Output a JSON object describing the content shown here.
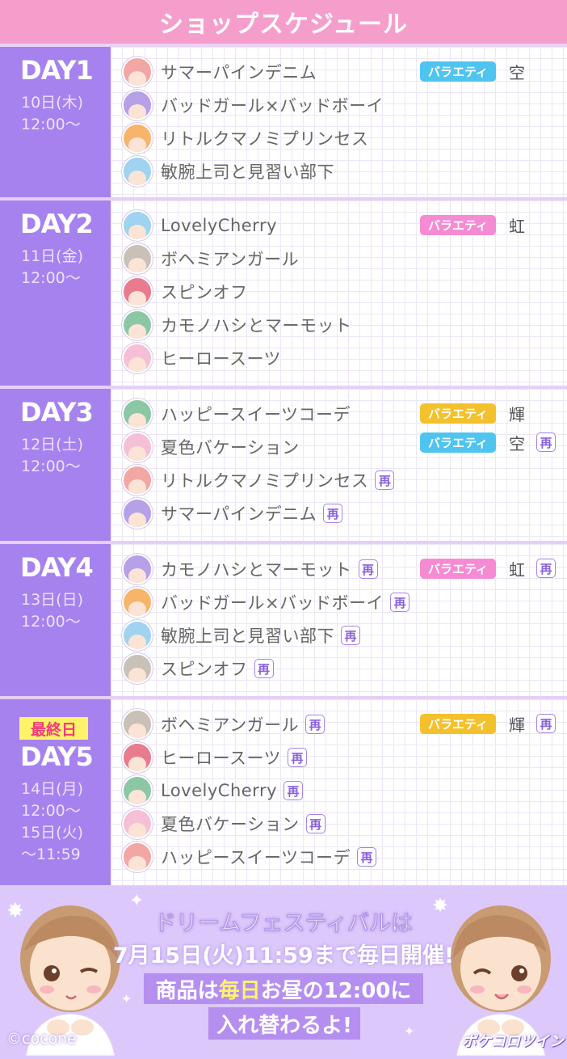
{
  "header": {
    "title": "ショップスケジュール"
  },
  "colors": {
    "header": "#f59ecb",
    "day_panel": "#a682ef",
    "variety_sky": "#4fc4ef",
    "variety_pink": "#f58bd3",
    "variety_gold": "#f3c12b",
    "final_badge": "#fff36a"
  },
  "re_label": "再",
  "days": [
    {
      "label": "DAY1",
      "info": "10日(木)\n12:00〜",
      "final_badge": "",
      "items": [
        {
          "name": "サマーパインデニム",
          "re": false,
          "icon": "avatar-icon"
        },
        {
          "name": "バッドガール×バッドボーイ",
          "re": false,
          "icon": "avatar-icon"
        },
        {
          "name": "リトルクマノミプリンセス",
          "re": false,
          "icon": "avatar-icon"
        },
        {
          "name": "敏腕上司と見習い部下",
          "re": false,
          "icon": "avatar-icon"
        }
      ],
      "variety": [
        {
          "badge": "バラエティ",
          "kind": "空",
          "color": "sky",
          "re": false
        }
      ]
    },
    {
      "label": "DAY2",
      "info": "11日(金)\n12:00〜",
      "final_badge": "",
      "items": [
        {
          "name": "LovelyCherry",
          "re": false,
          "icon": "avatar-icon"
        },
        {
          "name": "ボヘミアンガール",
          "re": false,
          "icon": "avatar-icon"
        },
        {
          "name": "スピンオフ",
          "re": false,
          "icon": "avatar-icon"
        },
        {
          "name": "カモノハシとマーモット",
          "re": false,
          "icon": "avatar-icon"
        },
        {
          "name": "ヒーロースーツ",
          "re": false,
          "icon": "avatar-icon"
        }
      ],
      "variety": [
        {
          "badge": "バラエティ",
          "kind": "虹",
          "color": "pink",
          "re": false
        }
      ]
    },
    {
      "label": "DAY3",
      "info": "12日(土)\n12:00〜",
      "final_badge": "",
      "items": [
        {
          "name": "ハッピースイーツコーデ",
          "re": false,
          "icon": "avatar-icon"
        },
        {
          "name": "夏色バケーション",
          "re": false,
          "icon": "avatar-icon"
        },
        {
          "name": "リトルクマノミプリンセス",
          "re": true,
          "icon": "avatar-icon"
        },
        {
          "name": "サマーパインデニム",
          "re": true,
          "icon": "avatar-icon"
        }
      ],
      "variety": [
        {
          "badge": "バラエティ",
          "kind": "輝",
          "color": "gold",
          "re": false
        },
        {
          "badge": "バラエティ",
          "kind": "空",
          "color": "sky",
          "re": true
        }
      ]
    },
    {
      "label": "DAY4",
      "info": "13日(日)\n12:00〜",
      "final_badge": "",
      "items": [
        {
          "name": "カモノハシとマーモット",
          "re": true,
          "icon": "avatar-icon"
        },
        {
          "name": "バッドガール×バッドボーイ",
          "re": true,
          "icon": "avatar-icon"
        },
        {
          "name": "敏腕上司と見習い部下",
          "re": true,
          "icon": "avatar-icon"
        },
        {
          "name": "スピンオフ",
          "re": true,
          "icon": "avatar-icon"
        }
      ],
      "variety": [
        {
          "badge": "バラエティ",
          "kind": "虹",
          "color": "pink",
          "re": true
        }
      ]
    },
    {
      "label": "DAY5",
      "info": "14日(月)\n12:00〜\n15日(火)\n〜11:59",
      "final_badge": "最終日",
      "items": [
        {
          "name": "ボヘミアンガール",
          "re": true,
          "icon": "avatar-icon"
        },
        {
          "name": "ヒーロースーツ",
          "re": true,
          "icon": "avatar-icon"
        },
        {
          "name": "LovelyCherry",
          "re": true,
          "icon": "avatar-icon"
        },
        {
          "name": "夏色バケーション",
          "re": true,
          "icon": "avatar-icon"
        },
        {
          "name": "ハッピースイーツコーデ",
          "re": true,
          "icon": "avatar-icon"
        }
      ],
      "variety": [
        {
          "badge": "バラエティ",
          "kind": "輝",
          "color": "gold",
          "re": true
        }
      ]
    }
  ],
  "footer": {
    "line1": "ドリームフェスティバルは",
    "line2": "7月15日(火)11:59まで毎日開催!",
    "line3_pre": "商品は",
    "line3_hl": "毎日",
    "line3_post": "お昼の12:00に",
    "line4": "入れ替わるよ!",
    "copyright": "©cocone",
    "logo": "ポケコロツイン"
  }
}
